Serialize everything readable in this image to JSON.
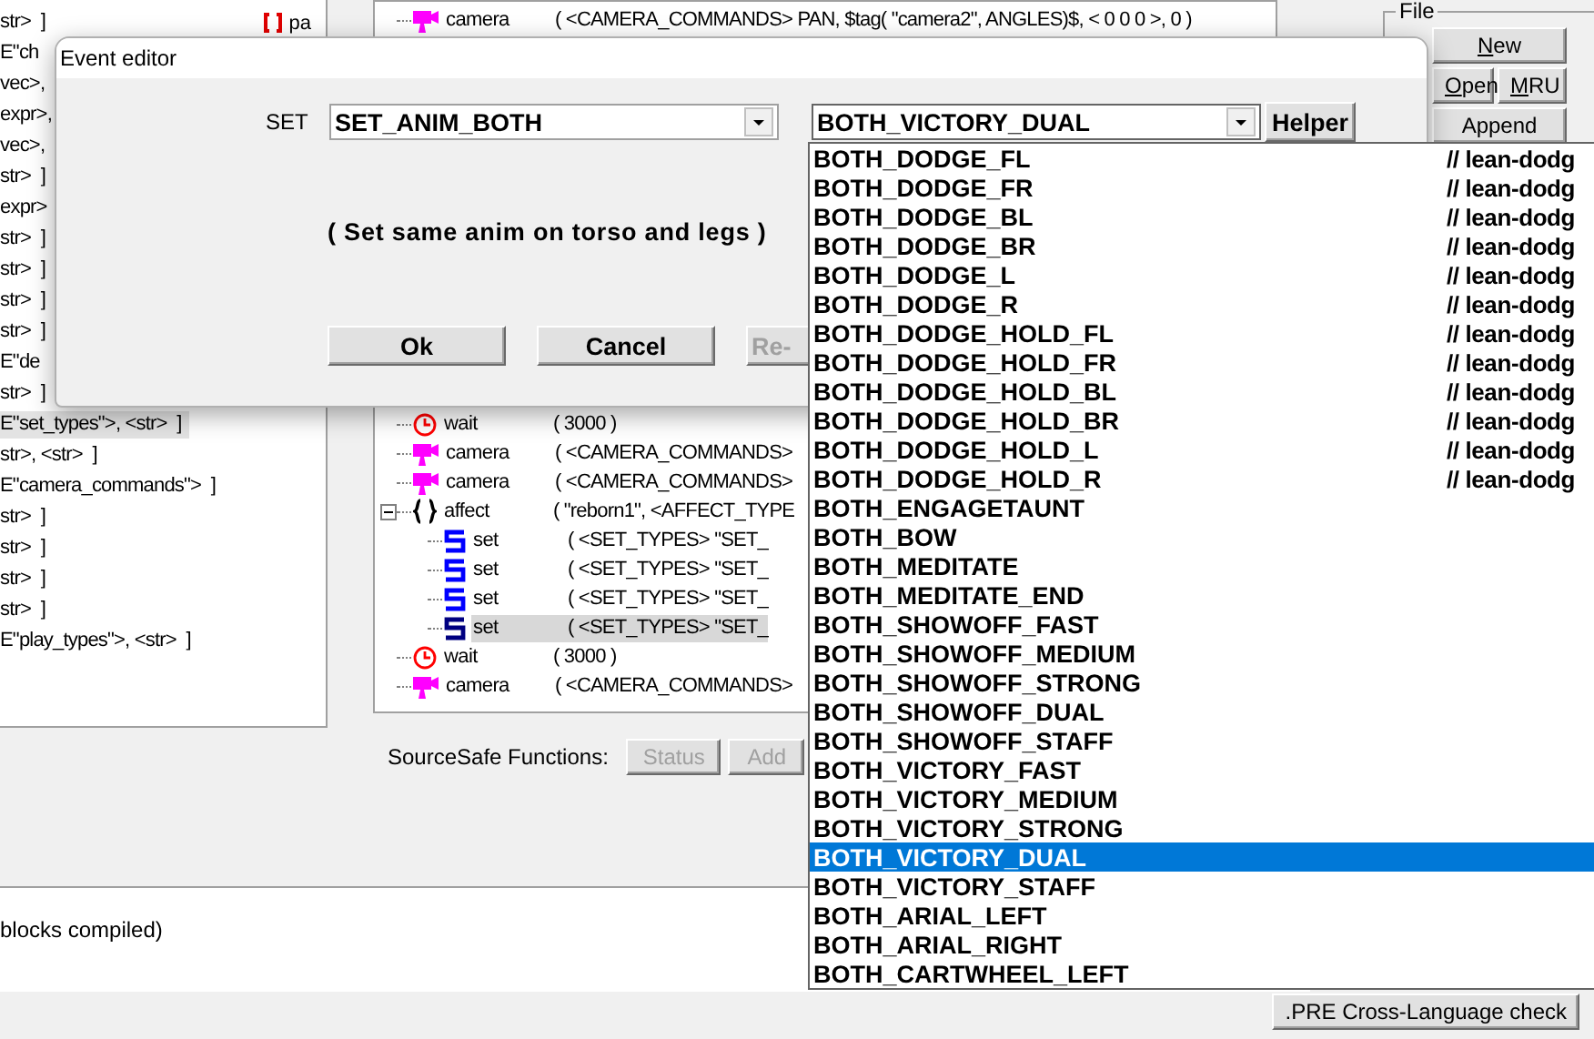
{
  "left_panel": {
    "tag": "pa",
    "lines": [
      {
        "text": "str>  ]",
        "highlighted": false
      },
      {
        "text": "E\"ch",
        "highlighted": false
      },
      {
        "text": "vec>,",
        "highlighted": false
      },
      {
        "text": "expr>,",
        "highlighted": false
      },
      {
        "text": "vec>,",
        "highlighted": false
      },
      {
        "text": "str>  ]",
        "highlighted": false
      },
      {
        "text": "expr>",
        "highlighted": false
      },
      {
        "text": "str>  ]",
        "highlighted": false
      },
      {
        "text": "str>  ]",
        "highlighted": false
      },
      {
        "text": "str>  ]",
        "highlighted": false
      },
      {
        "text": "str>  ]",
        "highlighted": false
      },
      {
        "text": "E\"de",
        "highlighted": false
      },
      {
        "text": "str>  ]",
        "highlighted": false
      },
      {
        "text": "E\"set_types\">, <str>  ]",
        "highlighted": true
      },
      {
        "text": "str>, <str>  ]",
        "highlighted": false
      },
      {
        "text": "E\"camera_commands\">  ]",
        "highlighted": false
      },
      {
        "text": "str>  ]",
        "highlighted": false
      },
      {
        "text": "str>  ]",
        "highlighted": false
      },
      {
        "text": "str>  ]",
        "highlighted": false
      },
      {
        "text": "str>  ]",
        "highlighted": false
      },
      {
        "text": "E\"play_types\">, <str>  ]",
        "highlighted": false
      }
    ]
  },
  "tree": {
    "top_rows": [
      {
        "kind": "camera",
        "label": "camera",
        "args": "( <CAMERA_COMMANDS> PAN, $tag( \"camera2\", ANGLES)$, < 0 0 0 >, 0 )",
        "selected": false
      }
    ],
    "rows": [
      {
        "kind": "wait",
        "label": "wait",
        "args": "( 3000 )",
        "selected": false
      },
      {
        "kind": "camera",
        "label": "camera",
        "args": "( <CAMERA_COMMANDS>",
        "selected": false
      },
      {
        "kind": "camera",
        "label": "camera",
        "args": "( <CAMERA_COMMANDS>",
        "selected": false
      },
      {
        "kind": "affect",
        "label": "affect",
        "args": "( \"reborn1\", <AFFECT_TYPE",
        "selected": false,
        "expanded": true,
        "children": [
          {
            "kind": "set",
            "label": "set",
            "args": "( <SET_TYPES> \"SET_",
            "selected": false
          },
          {
            "kind": "set",
            "label": "set",
            "args": "( <SET_TYPES> \"SET_",
            "selected": false
          },
          {
            "kind": "set",
            "label": "set",
            "args": "( <SET_TYPES> \"SET_",
            "selected": false
          },
          {
            "kind": "set",
            "label": "set",
            "args": "( <SET_TYPES> \"SET_",
            "selected": true
          }
        ]
      },
      {
        "kind": "wait",
        "label": "wait",
        "args": "( 3000 )",
        "selected": false
      },
      {
        "kind": "camera",
        "label": "camera",
        "args": "( <CAMERA_COMMANDS>",
        "selected": false
      }
    ]
  },
  "sourcesafe": {
    "label": "SourceSafe Functions:",
    "buttons": [
      {
        "label": "Status",
        "disabled": true
      },
      {
        "label": "Add",
        "disabled": true
      }
    ]
  },
  "file_group": {
    "title": "File",
    "buttons": [
      {
        "label": "New",
        "mnemonic": true
      },
      {
        "label": "Open",
        "mnemonic": true
      },
      {
        "label": "MRU",
        "mnemonic": true
      },
      {
        "label": "Append",
        "mnemonic": false
      }
    ]
  },
  "output": {
    "text": "blocks compiled)"
  },
  "status_button": ".PRE Cross-Language check",
  "dialog": {
    "title": "Event editor",
    "set_label": "SET",
    "combos": [
      {
        "value": "SET_ANIM_BOTH",
        "open": false
      },
      {
        "value": "BOTH_VICTORY_DUAL",
        "open": true
      }
    ],
    "helper": "Helper",
    "description": "( Set same anim on torso and legs )",
    "buttons": [
      {
        "label": "Ok",
        "disabled": false
      },
      {
        "label": "Cancel",
        "disabled": false
      },
      {
        "label": "Re-",
        "disabled": true
      }
    ]
  },
  "dropdown": {
    "options": [
      {
        "label": "BOTH_DODGE_FL",
        "comment": "// lean-dodg",
        "selected": false
      },
      {
        "label": "BOTH_DODGE_FR",
        "comment": "// lean-dodg",
        "selected": false
      },
      {
        "label": "BOTH_DODGE_BL",
        "comment": "// lean-dodg",
        "selected": false
      },
      {
        "label": "BOTH_DODGE_BR",
        "comment": "// lean-dodg",
        "selected": false
      },
      {
        "label": "BOTH_DODGE_L",
        "comment": "// lean-dodg",
        "selected": false
      },
      {
        "label": "BOTH_DODGE_R",
        "comment": "// lean-dodg",
        "selected": false
      },
      {
        "label": "BOTH_DODGE_HOLD_FL",
        "comment": "// lean-dodg",
        "selected": false
      },
      {
        "label": "BOTH_DODGE_HOLD_FR",
        "comment": "// lean-dodg",
        "selected": false
      },
      {
        "label": "BOTH_DODGE_HOLD_BL",
        "comment": "// lean-dodg",
        "selected": false
      },
      {
        "label": "BOTH_DODGE_HOLD_BR",
        "comment": "// lean-dodg",
        "selected": false
      },
      {
        "label": "BOTH_DODGE_HOLD_L",
        "comment": "// lean-dodg",
        "selected": false
      },
      {
        "label": "BOTH_DODGE_HOLD_R",
        "comment": "// lean-dodg",
        "selected": false
      },
      {
        "label": "BOTH_ENGAGETAUNT",
        "selected": false
      },
      {
        "label": "BOTH_BOW",
        "selected": false
      },
      {
        "label": "BOTH_MEDITATE",
        "selected": false
      },
      {
        "label": "BOTH_MEDITATE_END",
        "selected": false
      },
      {
        "label": "BOTH_SHOWOFF_FAST",
        "selected": false
      },
      {
        "label": "BOTH_SHOWOFF_MEDIUM",
        "selected": false
      },
      {
        "label": "BOTH_SHOWOFF_STRONG",
        "selected": false
      },
      {
        "label": "BOTH_SHOWOFF_DUAL",
        "selected": false
      },
      {
        "label": "BOTH_SHOWOFF_STAFF",
        "selected": false
      },
      {
        "label": "BOTH_VICTORY_FAST",
        "selected": false
      },
      {
        "label": "BOTH_VICTORY_MEDIUM",
        "selected": false
      },
      {
        "label": "BOTH_VICTORY_STRONG",
        "selected": false
      },
      {
        "label": "BOTH_VICTORY_DUAL",
        "selected": true
      },
      {
        "label": "BOTH_VICTORY_STAFF",
        "selected": false
      },
      {
        "label": "BOTH_ARIAL_LEFT",
        "selected": false
      },
      {
        "label": "BOTH_ARIAL_RIGHT",
        "selected": false
      },
      {
        "label": "BOTH_CARTWHEEL_LEFT",
        "selected": false
      }
    ]
  }
}
